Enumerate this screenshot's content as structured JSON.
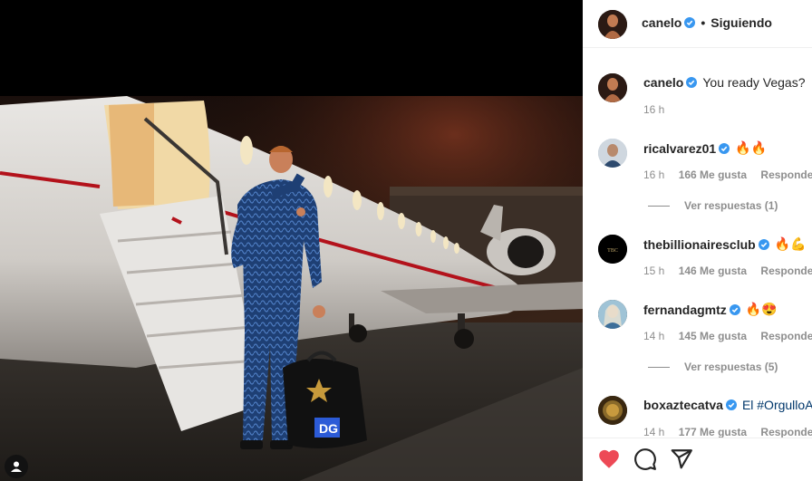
{
  "post": {
    "username": "canelo",
    "follow_status": "Siguiendo",
    "caption": "You ready Vegas?",
    "caption_time": "16 h",
    "image_alt": "Man in blue silk suit in front of private jet at night"
  },
  "comments": [
    {
      "username": "ricalvarez01",
      "text": "🔥🔥",
      "time": "16 h",
      "likes": "166 Me gusta",
      "reply": "Responder",
      "view_replies": "Ver respuestas (1)",
      "verified": true
    },
    {
      "username": "thebillionairesclub",
      "text": "🔥💪",
      "time": "15 h",
      "likes": "146 Me gusta",
      "reply": "Responder",
      "verified": true
    },
    {
      "username": "fernandagmtz",
      "text": "🔥😍",
      "time": "14 h",
      "likes": "145 Me gusta",
      "reply": "Responder",
      "view_replies": "Ver respuestas (5)",
      "verified": true
    },
    {
      "username": "boxaztecatva",
      "text": "El #OrgulloA",
      "time": "14 h",
      "likes": "177 Me gusta",
      "reply": "Responder",
      "verified": true
    }
  ],
  "colors": {
    "verified": "#3897f0",
    "heart": "#ed4956",
    "text": "#262626",
    "meta": "#8e8e8e"
  }
}
